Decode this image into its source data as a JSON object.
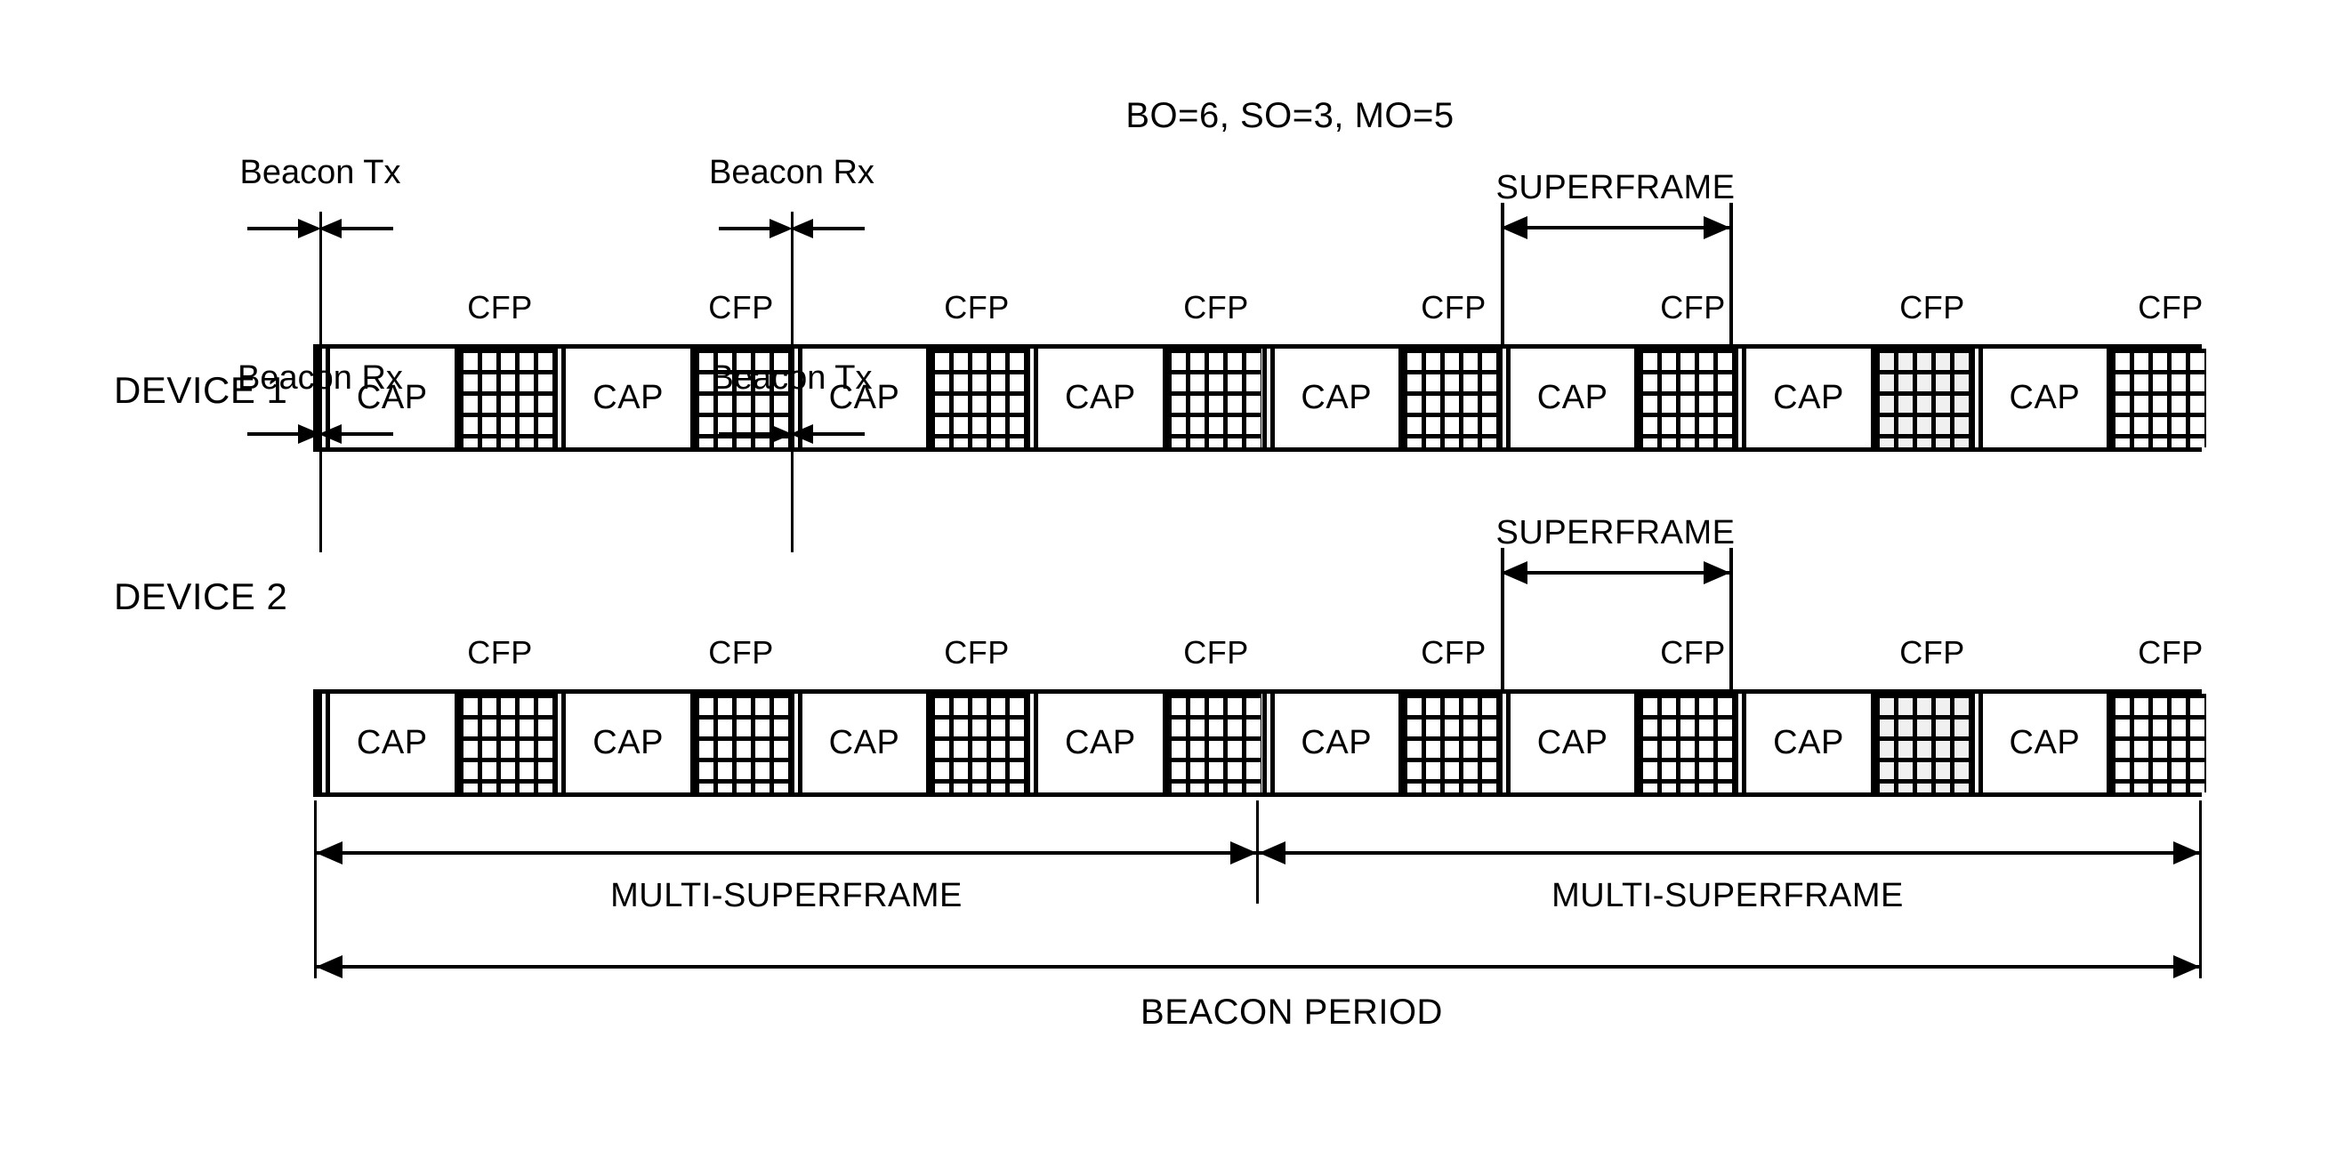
{
  "title": "BO=6, SO=3, MO=5",
  "rows": [
    {
      "label": "DEVICE 1",
      "beacon_callouts": [
        {
          "text": "Beacon Tx"
        },
        {
          "text": "Beacon Rx"
        }
      ],
      "superframe_bracket_label": "SUPERFRAME",
      "segments": [
        {
          "cap": "CAP",
          "cfp": "CFP"
        },
        {
          "cap": "CAP",
          "cfp": "CFP"
        },
        {
          "cap": "CAP",
          "cfp": "CFP"
        },
        {
          "cap": "CAP",
          "cfp": "CFP"
        },
        {
          "cap": "CAP",
          "cfp": "CFP"
        },
        {
          "cap": "CAP",
          "cfp": "CFP"
        },
        {
          "cap": "CAP",
          "cfp": "CFP"
        },
        {
          "cap": "CAP",
          "cfp": "CFP"
        }
      ]
    },
    {
      "label": "DEVICE 2",
      "beacon_callouts": [
        {
          "text": "Beacon Rx"
        },
        {
          "text": "Beacon Tx"
        }
      ],
      "superframe_bracket_label": "SUPERFRAME",
      "segments": [
        {
          "cap": "CAP",
          "cfp": "CFP"
        },
        {
          "cap": "CAP",
          "cfp": "CFP"
        },
        {
          "cap": "CAP",
          "cfp": "CFP"
        },
        {
          "cap": "CAP",
          "cfp": "CFP"
        },
        {
          "cap": "CAP",
          "cfp": "CFP"
        },
        {
          "cap": "CAP",
          "cfp": "CFP"
        },
        {
          "cap": "CAP",
          "cfp": "CFP"
        },
        {
          "cap": "CAP",
          "cfp": "CFP"
        }
      ]
    }
  ],
  "multi_superframes": [
    {
      "label": "MULTI-SUPERFRAME"
    },
    {
      "label": "MULTI-SUPERFRAME"
    }
  ],
  "beacon_period": {
    "label": "BEACON PERIOD"
  },
  "colors": {
    "ink": "#000000",
    "paper": "#ffffff",
    "cfp_tint": "#f0f0f0"
  }
}
